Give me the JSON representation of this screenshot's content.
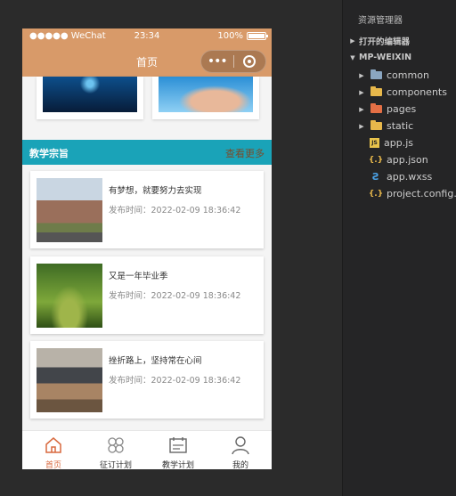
{
  "colors": {
    "nav_bg": "#d89a69",
    "section_bg": "#1aa3b8",
    "tab_active": "#d8693e",
    "editor_bg": "#282828",
    "explorer_bg": "#252526"
  },
  "status_bar": {
    "carrier": "●●●●● WeChat",
    "wifi_icon": "wifi-icon",
    "time": "23:34",
    "battery": "100%"
  },
  "nav": {
    "title": "首页",
    "more_icon": "•••",
    "close_icon": "close-circle-icon"
  },
  "section": {
    "title": "教学宗旨",
    "more_label": "查看更多"
  },
  "articles": [
    {
      "title": "有梦想，就要努力去实现",
      "date": "发布时间：2022-02-09 18:36:42",
      "thumb": "campus-building"
    },
    {
      "title": "又是一年毕业季",
      "date": "发布时间：2022-02-09 18:36:42",
      "thumb": "tree-lined-path"
    },
    {
      "title": "挫折路上，坚持常在心间",
      "date": "发布时间：2022-02-09 18:36:42",
      "thumb": "classroom"
    }
  ],
  "tabs": [
    {
      "label": "首页",
      "icon": "home-icon",
      "active": true
    },
    {
      "label": "征订计划",
      "icon": "grid-icon",
      "active": false
    },
    {
      "label": "教学计划",
      "icon": "calendar-icon",
      "active": false
    },
    {
      "label": "我的",
      "icon": "user-icon",
      "active": false
    }
  ],
  "explorer": {
    "title": "资源管理器",
    "open_editors": "打开的编辑器",
    "project": "MP-WEIXIN",
    "items": [
      {
        "name": "common",
        "type": "folder",
        "color": "#8aa6c1"
      },
      {
        "name": "components",
        "type": "folder",
        "color": "#e8b84b"
      },
      {
        "name": "pages",
        "type": "folder",
        "color": "#e46f45"
      },
      {
        "name": "static",
        "type": "folder",
        "color": "#e8b84b"
      },
      {
        "name": "app.js",
        "type": "js",
        "color": "#e8c34b"
      },
      {
        "name": "app.json",
        "type": "json",
        "color": "#e8b84b"
      },
      {
        "name": "app.wxss",
        "type": "css",
        "color": "#4ba3e8"
      },
      {
        "name": "project.config.json",
        "type": "json",
        "color": "#e8b84b"
      }
    ]
  }
}
